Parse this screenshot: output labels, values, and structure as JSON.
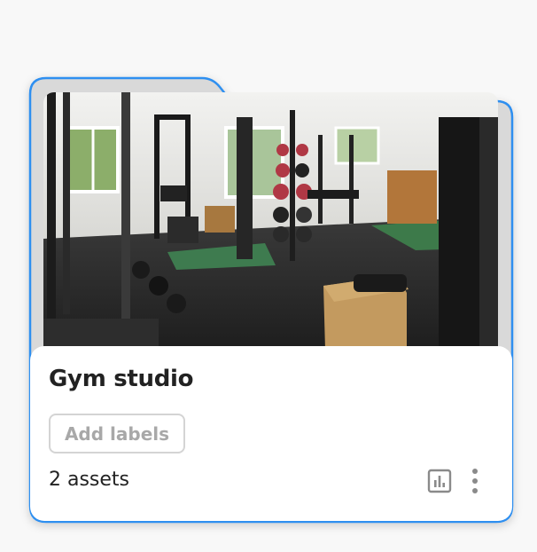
{
  "folder": {
    "title": "Gym studio",
    "add_labels_label": "Add labels",
    "asset_count_text": "2 assets",
    "thumbnail": "gym-interior-photo",
    "icons": {
      "stats": "bar-chart-icon",
      "menu": "more-vertical-icon"
    }
  },
  "colors": {
    "accent": "#2f8ff0",
    "card_bg": "#ffffff",
    "page_bg": "#f8f8f8",
    "folder_back": "#d7d7d7"
  }
}
